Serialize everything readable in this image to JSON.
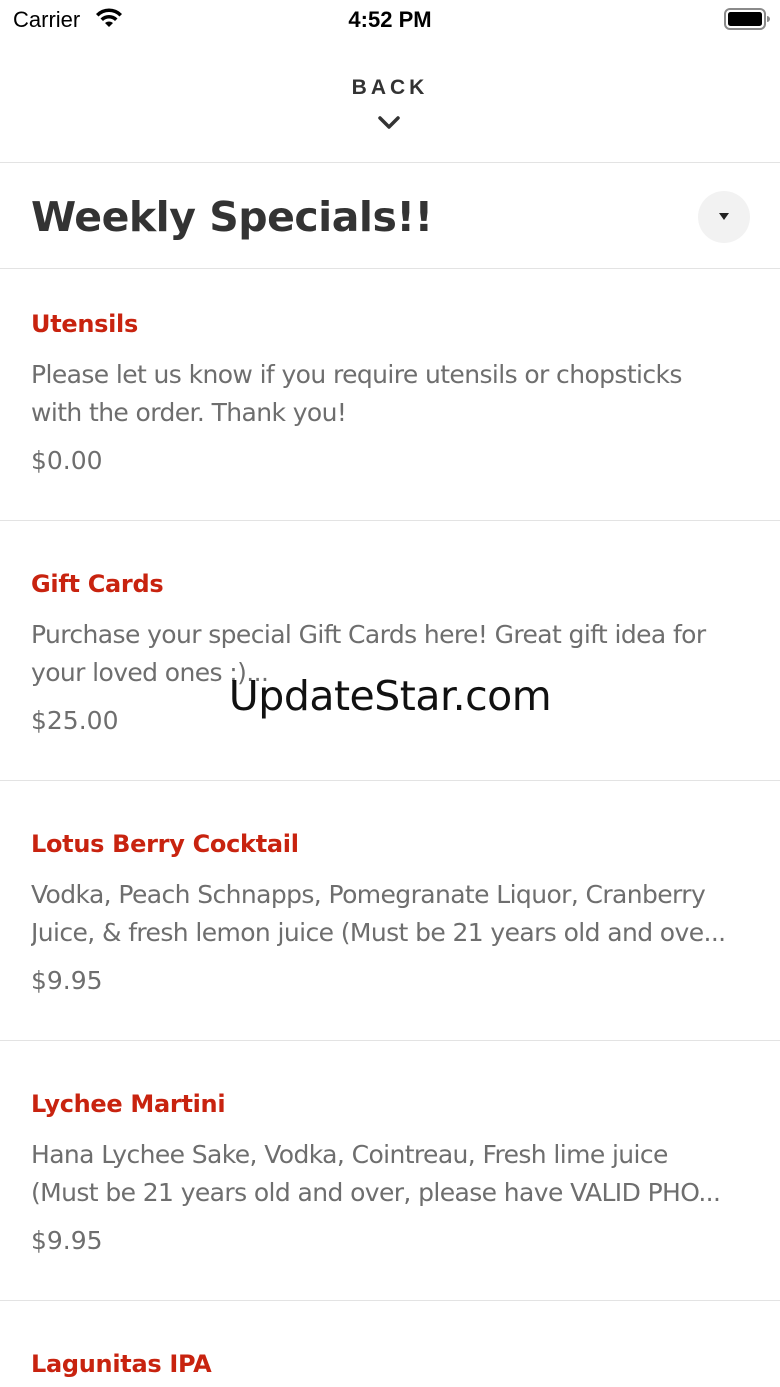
{
  "status_bar": {
    "carrier": "Carrier",
    "time": "4:52 PM",
    "wifi_icon": "wifi-icon",
    "battery_icon": "battery-icon"
  },
  "nav": {
    "back_label": "BACK",
    "chevron_icon": "chevron-down-icon"
  },
  "section": {
    "title": "Weekly Specials!!",
    "dropdown_icon": "caret-down-icon"
  },
  "items": [
    {
      "name": "Utensils",
      "desc_line1": "Please let us know if you require utensils or chopsticks",
      "desc_line2": "with the order.  Thank you!",
      "price": "$0.00"
    },
    {
      "name": "Gift Cards",
      "desc_line1": "Purchase your special Gift Cards here! Great gift idea for",
      "desc_line2": "your loved ones :)...",
      "price": "$25.00"
    },
    {
      "name": "Lotus Berry Cocktail",
      "desc_line1": "Vodka, Peach Schnapps, Pomegranate Liquor, Cranberry",
      "desc_line2": "Juice, & fresh lemon juice (Must be 21 years old and ove...",
      "price": "$9.95"
    },
    {
      "name": "Lychee Martini",
      "desc_line1": "Hana Lychee Sake, Vodka, Cointreau, Fresh lime juice",
      "desc_line2": "(Must be 21 years old and over, please have VALID PHO...",
      "price": "$9.95"
    },
    {
      "name": "Lagunitas IPA",
      "desc_line1": "",
      "desc_line2": "",
      "price": ""
    }
  ],
  "watermark": "UpdateStar.com",
  "colors": {
    "accent": "#c8230f",
    "title": "#333333",
    "body_text": "#6e6e6e",
    "divider": "#e3e3e3"
  }
}
